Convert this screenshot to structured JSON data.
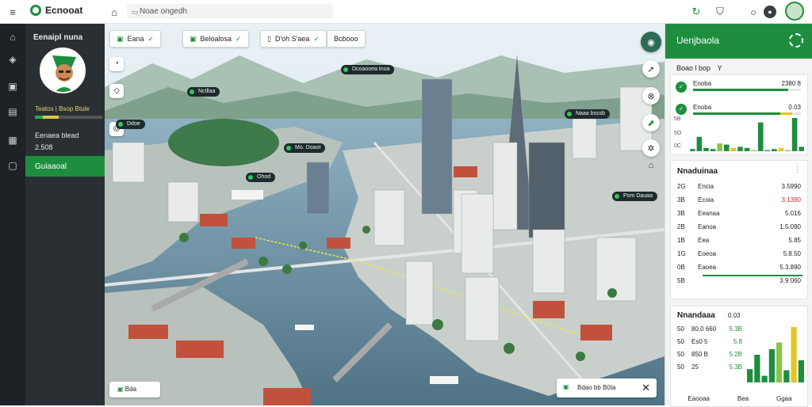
{
  "topbar": {
    "brand": "Ecnooat",
    "address": "Noae ongedh",
    "icons": [
      "menu-icon",
      "home-icon",
      "lock-icon",
      "refresh-icon",
      "shield-icon",
      "notification-icon",
      "profile-icon"
    ]
  },
  "rail": {
    "icons": [
      "home-icon",
      "layers-icon",
      "inbox-icon",
      "chart-icon",
      "table-icon",
      "folder-icon"
    ]
  },
  "left_panel": {
    "title": "Eenaipl nuna",
    "status_line": "Teatos | Bsop Btule",
    "name": "Eenaea blead",
    "value": "2.508",
    "button": "Guiaaoal"
  },
  "map": {
    "chips": [
      "Eana",
      "Beloalosa",
      "D'oh S'aea",
      "Bcbooo"
    ],
    "pins": [
      "Dcoaooea tnoa",
      "Nctllaa",
      "Ddoe",
      "Mo. Doaot",
      "Naaa bsssb",
      "Ohod",
      "Pom Dauaa"
    ],
    "bottom_left": "Bda",
    "bottom_right": "Bdao bb  B0Ia"
  },
  "right_panel": {
    "header": "Uenjbaola",
    "filter_label": "Boao l bop",
    "filter_value": "Y",
    "kpis": [
      {
        "label": "Enoba",
        "value": "2380 8",
        "progress": 0.88
      },
      {
        "label": "Enoba",
        "value": "0.03",
        "progress": 0.92
      }
    ],
    "chart1": {
      "y_ticks": [
        "5B",
        "5O",
        "0C"
      ],
      "values": [
        2,
        13,
        3,
        2,
        7,
        6,
        3,
        4,
        3,
        1,
        26,
        1,
        2,
        3,
        1,
        30,
        4
      ]
    },
    "table_title": "Nnaduinaa",
    "table_rows": [
      {
        "rank": "2G",
        "name": "Encia",
        "value": "3.5990",
        "sign": "pos"
      },
      {
        "rank": "3B",
        "name": "Ecoia",
        "value": "3.1390",
        "sign": "neg"
      },
      {
        "rank": "3B",
        "name": "Eeanaa",
        "value": "5.016",
        "sign": "pos"
      },
      {
        "rank": "2B",
        "name": "Eanoa",
        "value": "1.5.090",
        "sign": "pos"
      },
      {
        "rank": "1B",
        "name": "Eea",
        "value": "5.85",
        "sign": "pos"
      },
      {
        "rank": "1G",
        "name": "Eoeoa",
        "value": "5.8.50",
        "sign": "pos"
      },
      {
        "rank": "0B",
        "name": "Eaoea",
        "value": "5.3.890",
        "sign": "pos"
      },
      {
        "rank": "5B",
        "name": "",
        "value": "3.9 060",
        "sign": "pos"
      }
    ],
    "chart2_title": "Nnandaaa",
    "chart2_title_value": "0.03",
    "chart2_rows": [
      {
        "rank": "50",
        "label": "80.0 660",
        "value": "5.3B"
      },
      {
        "rank": "50",
        "label": "Es0 5",
        "value": "5.8"
      },
      {
        "rank": "50",
        "label": "850 B",
        "value": "5.2B"
      },
      {
        "rank": "50",
        "label": "25",
        "value": "5.3B"
      }
    ],
    "chart2_values": [
      12,
      25,
      6,
      30,
      36,
      11,
      50,
      20
    ],
    "footer_tabs": [
      "Eaooaa",
      "Bea",
      "Ggaa"
    ]
  }
}
